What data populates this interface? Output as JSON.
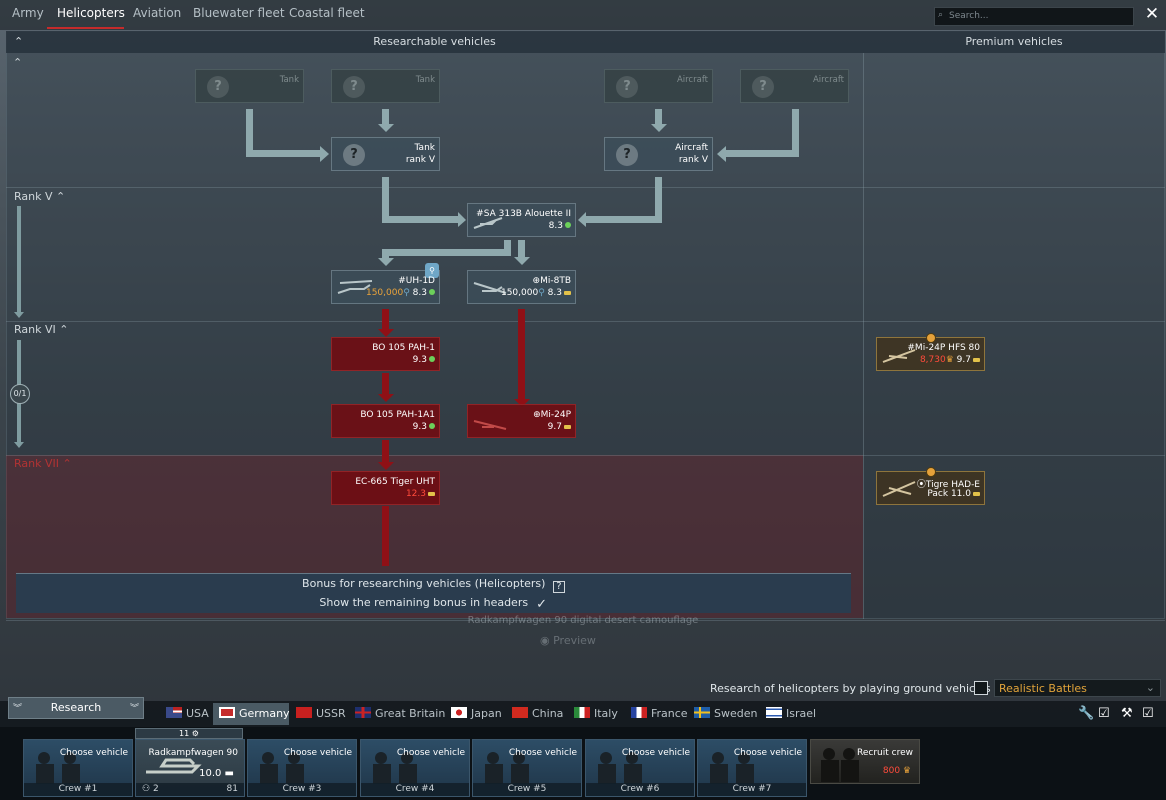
{
  "tabs": [
    "Army",
    "Helicopters",
    "Aviation",
    "Bluewater fleet",
    "Coastal fleet"
  ],
  "search_placeholder": "Search...",
  "close_glyph": "✕",
  "headers": {
    "researchable": "Researchable vehicles",
    "premium": "Premium vehicles"
  },
  "ranks": {
    "v": "Rank V",
    "vi": "Rank VI",
    "vii": "Rank VII",
    "counter": "0/1"
  },
  "vehicles": {
    "tank_locked_a": {
      "name": "Tank"
    },
    "tank_locked_b": {
      "name": "Tank"
    },
    "aircraft_locked_a": {
      "name": "Aircraft"
    },
    "aircraft_locked_b": {
      "name": "Aircraft"
    },
    "tank_rank": {
      "name": "Tank",
      "sub": "rank V"
    },
    "aircraft_rank": {
      "name": "Aircraft",
      "sub": "rank V"
    },
    "alouette": {
      "name": "#SA 313B Alouette II",
      "br": "8.3"
    },
    "uh1d": {
      "name": "#UH-1D",
      "cost": "150,000",
      "br": "8.3"
    },
    "mi8tb": {
      "name": "⊕Mi-8TB",
      "cost": "150,000",
      "br": "8.3"
    },
    "bo105": {
      "name": "BO 105 PAH-1",
      "br": "9.3"
    },
    "bo105a1": {
      "name": "BO 105 PAH-1A1",
      "br": "9.3"
    },
    "mi24p": {
      "name": "⊕Mi-24P",
      "br": "9.7"
    },
    "tiger": {
      "name": "EC-665 Tiger UHT",
      "br": "12.3"
    },
    "mi24phfs": {
      "name": "#Mi-24P HFS 80",
      "cost": "8,730",
      "br": "9.7"
    },
    "tigre": {
      "name": "⦿Tigre HAD-E",
      "sub": "Pack",
      "br": "11.0"
    }
  },
  "bonus": {
    "title": "Bonus for researching vehicles (Helicopters)",
    "help": "?",
    "show": "Show the remaining bonus in headers",
    "check": "✓"
  },
  "camo": "Radkampfwagen 90 digital desert camouflage",
  "preview": "Preview",
  "research_toggle": "Research of helicopters by playing ground vehicles",
  "mode": "Realistic Battles",
  "research_button": "Research",
  "nations": [
    "USA",
    "Germany",
    "USSR",
    "Great Britain",
    "Japan",
    "China",
    "Italy",
    "France",
    "Sweden",
    "Israel"
  ],
  "crews": {
    "choose": "Choose vehicle",
    "slots": [
      "Crew #1",
      "",
      "Crew #3",
      "Crew #4",
      "Crew #5",
      "Crew #6",
      "Crew #7"
    ],
    "selected": {
      "vehicle": "Radkampfwagen 90",
      "br": "10.0",
      "count_top": "11",
      "left_num": "2",
      "right_num": "81"
    }
  },
  "recruit": {
    "label": "Recruit crew",
    "cost": "800"
  },
  "colors": {
    "accent_red": "#c52b2b",
    "gold": "#e9a33b",
    "br_green": "#6cd05a"
  }
}
